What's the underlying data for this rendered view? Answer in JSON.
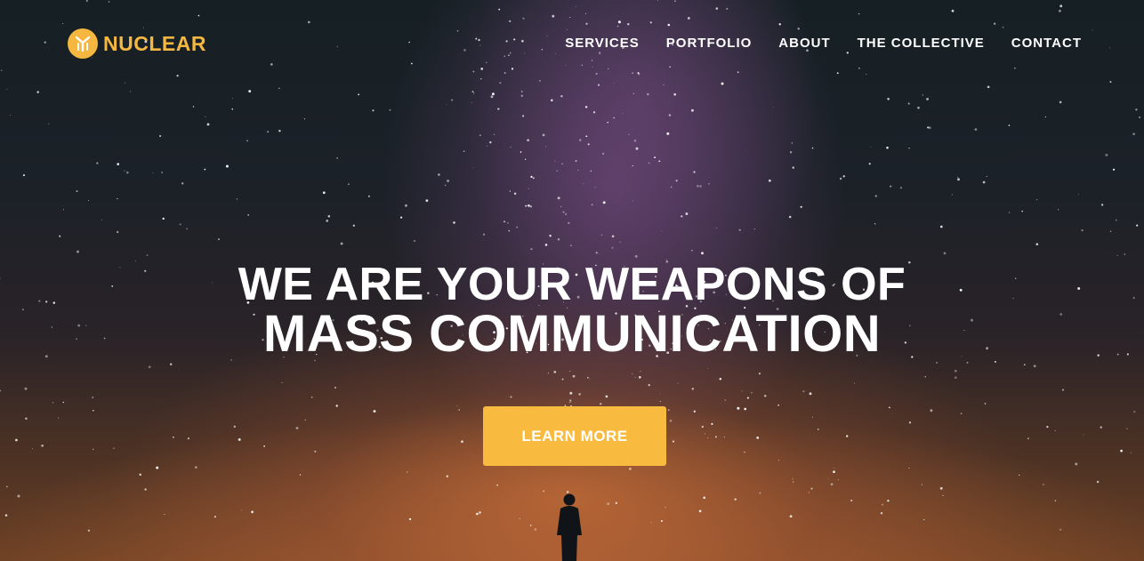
{
  "brand": {
    "name": "NUCLEAR",
    "color": "#f5b740",
    "icon": "nuclear-logo-icon"
  },
  "nav": {
    "items": [
      {
        "label": "SERVICES"
      },
      {
        "label": "PORTFOLIO"
      },
      {
        "label": "ABOUT"
      },
      {
        "label": "THE COLLECTIVE"
      },
      {
        "label": "CONTACT"
      }
    ]
  },
  "hero": {
    "headline_line1": "WE ARE YOUR WEAPONS OF",
    "headline_line2": "MASS COMMUNICATION",
    "cta_label": "LEARN MORE",
    "cta_color": "#f8bb40",
    "background": "starry night sky with silhouette"
  }
}
